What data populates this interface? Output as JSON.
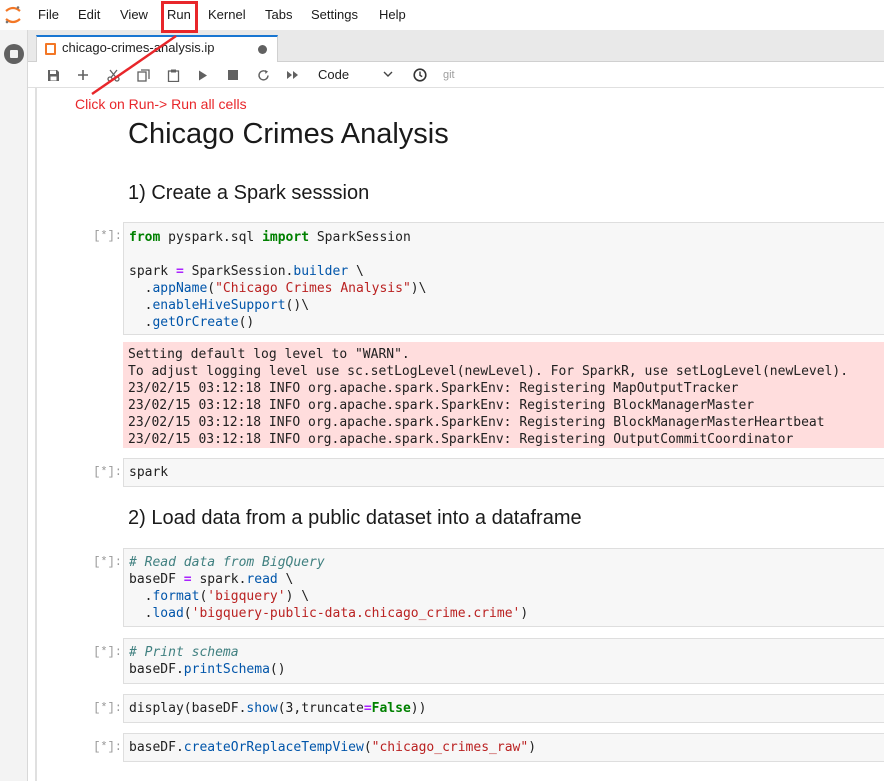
{
  "menubar": {
    "items": [
      "File",
      "Edit",
      "View",
      "Run",
      "Kernel",
      "Tabs",
      "Settings",
      "Help"
    ]
  },
  "tab": {
    "title": "chicago-crimes-analysis.ip"
  },
  "toolbar": {
    "cell_type": "Code",
    "git_label": "git"
  },
  "annotation": {
    "text": "Click on Run-> Run all cells",
    "color": "#e8262a"
  },
  "notebook": {
    "title": "Chicago Crimes Analysis",
    "section1": "1) Create a Spark sesssion",
    "section2": "2) Load data from a public dataset into a dataframe",
    "prompt": "[*]:",
    "cell1": {
      "line1_kw1": "from",
      "line1_mod": " pyspark.sql ",
      "line1_kw2": "import",
      "line1_rest": " SparkSession",
      "line3_a": "spark ",
      "line3_op": "=",
      "line3_b": " SparkSession.",
      "line3_fn": "builder",
      "line3_c": " \\",
      "line4_a": "  .",
      "line4_fn": "appName",
      "line4_b": "(",
      "line4_str": "\"Chicago Crimes Analysis\"",
      "line4_c": ")\\",
      "line5_a": "  .",
      "line5_fn": "enableHiveSupport",
      "line5_b": "()\\",
      "line6_a": "  .",
      "line6_fn": "getOrCreate",
      "line6_b": "()"
    },
    "cell1_output": [
      "Setting default log level to \"WARN\".",
      "To adjust logging level use sc.setLogLevel(newLevel). For SparkR, use setLogLevel(newLevel).",
      "23/02/15 03:12:18 INFO org.apache.spark.SparkEnv: Registering MapOutputTracker",
      "23/02/15 03:12:18 INFO org.apache.spark.SparkEnv: Registering BlockManagerMaster",
      "23/02/15 03:12:18 INFO org.apache.spark.SparkEnv: Registering BlockManagerMasterHeartbeat",
      "23/02/15 03:12:18 INFO org.apache.spark.SparkEnv: Registering OutputCommitCoordinator"
    ],
    "cell2": "spark",
    "cell3": {
      "comment": "# Read data from BigQuery",
      "l2_a": "baseDF ",
      "l2_op": "=",
      "l2_b": " spark.",
      "l2_fn": "read",
      "l2_c": " \\",
      "l3_a": "  .",
      "l3_fn": "format",
      "l3_b": "(",
      "l3_str": "'bigquery'",
      "l3_c": ") \\",
      "l4_a": "  .",
      "l4_fn": "load",
      "l4_b": "(",
      "l4_str": "'bigquery-public-data.chicago_crime.crime'",
      "l4_c": ")"
    },
    "cell4": {
      "comment": "# Print schema",
      "l2_a": "baseDF.",
      "l2_fn": "printSchema",
      "l2_b": "()"
    },
    "cell5": {
      "a": "display(baseDF.",
      "fn": "show",
      "b": "(3,truncate",
      "op": "=",
      "kw": "False",
      "c": "))"
    },
    "cell6": {
      "a": "baseDF.",
      "fn": "createOrReplaceTempView",
      "b": "(",
      "str": "\"chicago_crimes_raw\"",
      "c": ")"
    }
  }
}
